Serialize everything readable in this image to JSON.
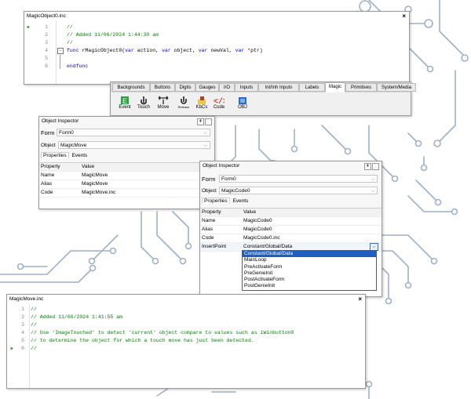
{
  "editor1": {
    "title": "MagicObject0.inc",
    "lines": [
      {
        "num": "1",
        "text": "//"
      },
      {
        "num": "2",
        "text": "// Added 11/06/2024 1:44:30 am"
      },
      {
        "num": "3",
        "text": "//"
      },
      {
        "num": "4",
        "text": ""
      },
      {
        "num": "5",
        "text": ""
      },
      {
        "num": "6",
        "text": ""
      }
    ],
    "func_line": {
      "kw1": "func",
      "name": " rMagicObject0(",
      "kw2": "var",
      "p1": " action, ",
      "kw3": "var",
      "p2": " object, ",
      "kw4": "var",
      "p3": " newVal, ",
      "kw5": "var",
      "p4": " *ptr)"
    },
    "endfunc": "endfunc"
  },
  "toolbar": {
    "tabs": [
      "Backgrounds",
      "Buttons",
      "Digits",
      "Gauges",
      "I/O",
      "Inputs",
      "Int/Inh Inputs",
      "Labels",
      "Magic",
      "Primitives",
      "System/Media"
    ],
    "active_tab": "Magic",
    "items": [
      {
        "label": "Event",
        "icon": "event-icon"
      },
      {
        "label": "Touch",
        "icon": "touch-icon"
      },
      {
        "label": "Move",
        "icon": "move-icon"
      },
      {
        "label": "Release",
        "icon": "release-icon"
      },
      {
        "label": "KbCs",
        "icon": "kbcs-icon"
      },
      {
        "label": "Code",
        "icon": "code-icon"
      },
      {
        "label": "OBJ",
        "icon": "obj-icon"
      }
    ]
  },
  "inspector1": {
    "title": "Object Inspector",
    "form_label": "Form",
    "form_value": "Form0",
    "object_label": "Object",
    "object_value": "MagicMove",
    "tab_properties": "Properties",
    "tab_events": "Events",
    "col_property": "Property",
    "col_value": "Value",
    "rows": [
      {
        "property": "Name",
        "value": "MagicMove"
      },
      {
        "property": "Alias",
        "value": "MagicMove"
      },
      {
        "property": "Code",
        "value": "MagicMove.inc"
      }
    ]
  },
  "inspector2": {
    "title": "Object Inspector",
    "form_label": "Form",
    "form_value": "Form0",
    "object_label": "Object",
    "object_value": "MagicCode0",
    "tab_properties": "Properties",
    "tab_events": "Events",
    "col_property": "Property",
    "col_value": "Value",
    "rows": [
      {
        "property": "Name",
        "value": "MagicCode0"
      },
      {
        "property": "Alias",
        "value": "MagicCode0"
      },
      {
        "property": "Code",
        "value": "MagicCode0.inc"
      },
      {
        "property": "InsertPoint",
        "value": "Constant/Global/Data"
      }
    ],
    "dropdown_options": [
      "Constant/Global/Data",
      "MainLoop",
      "PreActivateForm",
      "PreGenieInit",
      "PostActivateForm",
      "PostGenieInit"
    ],
    "dropdown_selected": "Constant/Global/Data"
  },
  "editor2": {
    "title": "MagicMove.inc",
    "lines": [
      {
        "num": "1",
        "text": "//"
      },
      {
        "num": "2",
        "text": "// Added 11/06/2024 1:41:55 am"
      },
      {
        "num": "3",
        "text": "//"
      },
      {
        "num": "4",
        "text": "// Use 'ImageTouched' to detect 'current' object compare to values such as iWinbutton0"
      },
      {
        "num": "5",
        "text": "// to determine the object for which a touch move has just been detected."
      },
      {
        "num": "6",
        "text": "//"
      }
    ]
  },
  "colors": {
    "comment": "#008000",
    "keyword": "#0000ff",
    "selection": "#1f5fbf",
    "marker": "#2ea02e",
    "circuit": "#8fa3bf"
  }
}
